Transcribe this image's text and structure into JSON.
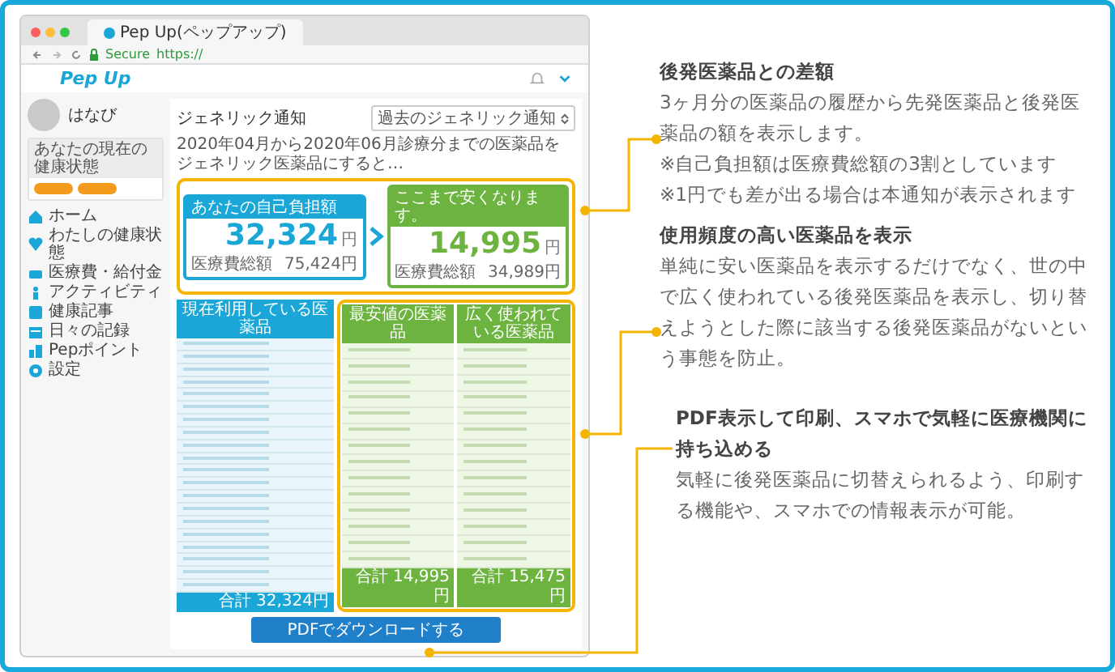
{
  "browser": {
    "tab_title": "Pep Up(ペップアップ)",
    "secure_label": "Secure",
    "url": "https://"
  },
  "app": {
    "logo": "Pep Up"
  },
  "profile": {
    "name": "はなび",
    "health_title": "あなたの現在の健康状態"
  },
  "nav": [
    {
      "label": "ホーム"
    },
    {
      "label": "わたしの健康状態"
    },
    {
      "label": "医療費・給付金"
    },
    {
      "label": "アクティビティ"
    },
    {
      "label": "健康記事"
    },
    {
      "label": "日々の記録"
    },
    {
      "label": "Pepポイント"
    },
    {
      "label": "設定"
    }
  ],
  "main": {
    "title": "ジェネリック通知",
    "select": "過去のジェネリック通知",
    "description": "2020年04月から2020年06月診療分までの医薬品をジェネリック医薬品にすると…",
    "cards": [
      {
        "label": "あなたの自己負担額",
        "amount": "32,324",
        "unit": "円",
        "total_label": "医療費総額",
        "total": "75,424円"
      },
      {
        "label": "ここまで安くなります。",
        "amount": "14,995",
        "unit": "円",
        "total_label": "医療費総額",
        "total": "34,989円"
      }
    ],
    "table": {
      "columns": [
        "現在利用している医薬品",
        "最安値の医薬品",
        "広く使われている医薬品"
      ],
      "totals": [
        "合計 32,324円",
        "合計 14,995円",
        "合計 15,475円"
      ]
    },
    "download_button": "PDFでダウンロードする"
  },
  "notes": [
    {
      "title": "後発医薬品との差額",
      "paragraphs": [
        "3ヶ月分の医薬品の履歴から先発医薬品と後発医薬品の額を表示します。",
        "※自己負担額は医療費総額の3割としています",
        "※1円でも差が出る場合は本通知が表示されます"
      ]
    },
    {
      "title": "使用頻度の高い医薬品を表示",
      "paragraphs": [
        "単純に安い医薬品を表示するだけでなく、世の中で広く使われている後発医薬品を表示し、切り替えようとした際に該当する後発医薬品がないという事態を防止。"
      ]
    },
    {
      "title": "PDF表示して印刷、スマホで気軽に医療機関に持ち込める",
      "paragraphs": [
        "気軽に後発医薬品に切替えられるよう、印刷する機能や、スマホでの情報表示が可能。"
      ]
    }
  ]
}
